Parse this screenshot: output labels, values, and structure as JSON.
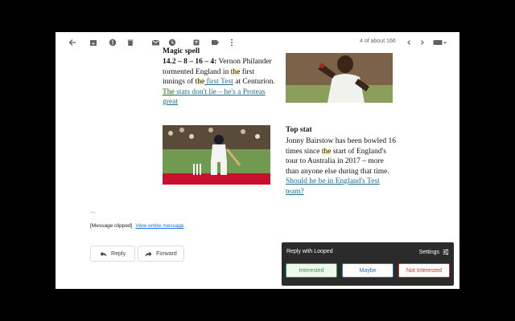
{
  "toolbar": {
    "icons": [
      "back-arrow-icon",
      "archive-icon",
      "report-spam-icon",
      "delete-icon",
      "mark-unread-icon",
      "snooze-icon",
      "add-to-tasks-icon",
      "label-icon",
      "more-vert-icon"
    ],
    "pagination": "4 of about 166"
  },
  "article": {
    "heading1": "Magic spell",
    "stat1_figures": "14.2 – 8 – 16 – 4:",
    "stat1_text_a": " Vernon Philander tormented England in ",
    "stat1_the1": "the",
    "stat1_text_b": " first innings of ",
    "stat1_the2": "the",
    "stat1_link_a": " first Test",
    "stat1_text_c": " at Centurion. ",
    "stat1_the3": "The",
    "stat1_link_b": " stats don't lie – he's a Proteas great",
    "heading2": "Top stat",
    "stat2_text_a": "Jonny Bairstow has been bowled 16 times since ",
    "stat2_the1": "the",
    "stat2_text_b": " start of England's tour to Australia in 2017 – more than anyone else during that time. ",
    "stat2_link": "Should he be in England's Test team?"
  },
  "message": {
    "ellipsis": "...",
    "clipped_label": "[Message clipped]",
    "view_entire": "View entire message"
  },
  "actions": {
    "reply": "Reply",
    "forward": "Forward"
  },
  "looped": {
    "title": "Reply with Looped",
    "settings": "Settings",
    "interested": "Interested",
    "maybe": "Maybe",
    "not_interested": "Not Interested",
    "colors": {
      "interested": "#3a9a4a",
      "maybe": "#2a6fc9",
      "not_interested": "#d93025"
    }
  }
}
